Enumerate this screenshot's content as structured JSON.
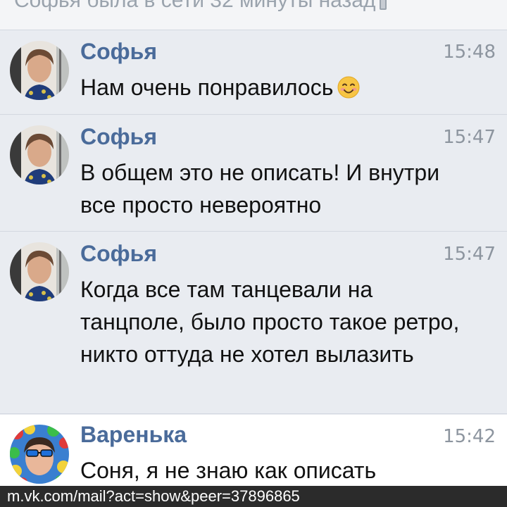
{
  "header": {
    "status_text": "Софья была в сети 32 минуты назад",
    "status_icon": "mobile-phone-icon"
  },
  "messages": [
    {
      "sender": "Софья",
      "time": "15:48",
      "text": "Нам очень понравилось",
      "emoji": "smiling-face-icon",
      "avatar": "sofya-avatar",
      "unread": true
    },
    {
      "sender": "Софья",
      "time": "15:47",
      "text": "В общем это не описать! И внутри все просто невероятно",
      "avatar": "sofya-avatar",
      "unread": true
    },
    {
      "sender": "Софья",
      "time": "15:47",
      "text": "Когда все там танцевали на танцполе, было просто такое ретро, никто оттуда не хотел вылазить",
      "avatar": "sofya-avatar",
      "unread": true
    },
    {
      "sender": "Варенька",
      "time": "15:42",
      "text": "Соня, я не знаю как описать",
      "avatar": "varenka-avatar",
      "unread": false
    }
  ],
  "url_bar": {
    "url": "m.vk.com/mail?act=show&peer=37896865"
  },
  "colors": {
    "sender_name": "#4a6b9a",
    "unread_background": "#e9ecf1",
    "read_background": "#ffffff",
    "url_bar_background": "#2b2b2b"
  }
}
